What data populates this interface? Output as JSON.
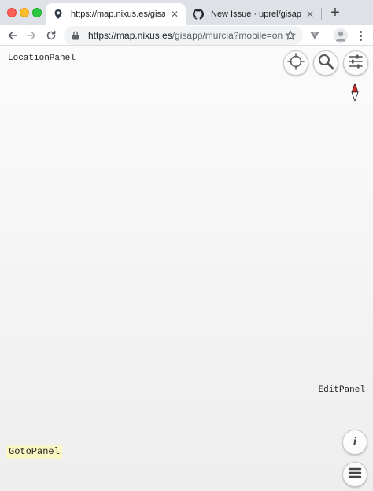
{
  "browser": {
    "tabs": [
      {
        "title": "https://map.nixus.es/gisapp/m",
        "active": true,
        "icon": "map-pin-icon"
      },
      {
        "title": "New Issue · uprel/gisapp",
        "active": false,
        "icon": "github-icon"
      }
    ],
    "new_tab_label": "+",
    "close_glyph": "✕",
    "url": {
      "host": "https://map.nixus.es",
      "path": "/gisapp/murcia?mobile=on"
    }
  },
  "map": {
    "location_panel_label": "LocationPanel",
    "edit_panel_label": "EditPanel",
    "goto_panel_label": "GotoPanel",
    "info_button_glyph": "i",
    "controls": [
      "crosshair-icon",
      "search-icon",
      "sliders-icon",
      "compass-icon",
      "info-icon",
      "hamburger-menu-icon"
    ]
  },
  "colors": {
    "goto_highlight": "#fbf7c4",
    "compass_north": "#d62828",
    "tabstrip": "#dee1e6"
  }
}
